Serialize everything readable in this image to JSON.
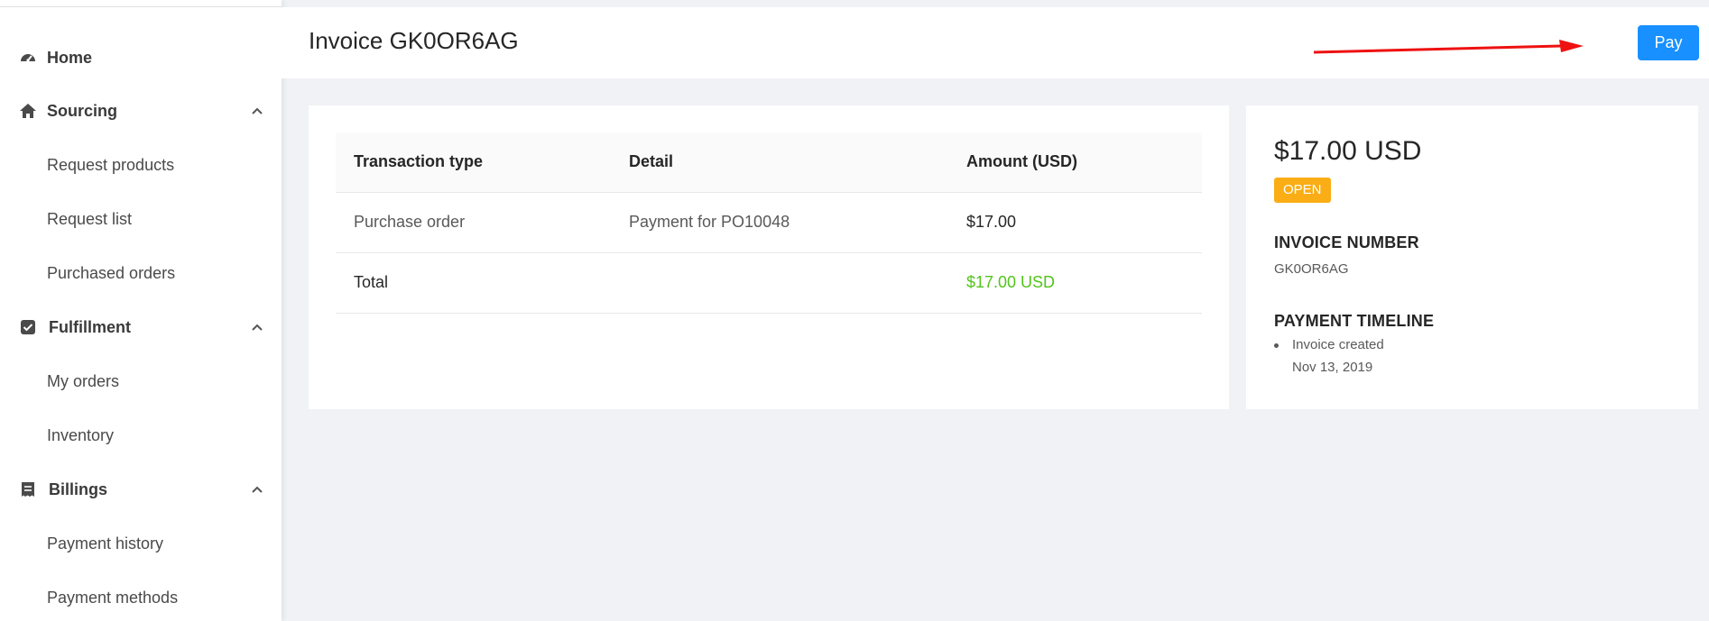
{
  "sidebar": {
    "items": [
      {
        "label": "Home",
        "icon": "dashboard-icon"
      },
      {
        "label": "Sourcing",
        "icon": "home-icon",
        "expanded": true,
        "children": [
          {
            "label": "Request products"
          },
          {
            "label": "Request list"
          },
          {
            "label": "Purchased orders"
          }
        ]
      },
      {
        "label": "Fulfillment",
        "icon": "check-square-icon",
        "expanded": true,
        "children": [
          {
            "label": "My orders"
          },
          {
            "label": "Inventory"
          }
        ]
      },
      {
        "label": "Billings",
        "icon": "receipt-icon",
        "expanded": true,
        "children": [
          {
            "label": "Payment history"
          },
          {
            "label": "Payment methods"
          }
        ]
      }
    ]
  },
  "header": {
    "title": "Invoice GK0OR6AG",
    "pay_label": "Pay"
  },
  "table": {
    "columns": [
      "Transaction type",
      "Detail",
      "Amount (USD)"
    ],
    "rows": [
      {
        "type": "Purchase order",
        "detail": "Payment for PO10048",
        "amount": "$17.00"
      }
    ],
    "total": {
      "label": "Total",
      "amount": "$17.00 USD"
    }
  },
  "summary": {
    "amount": "$17.00 USD",
    "status": "OPEN",
    "invoice_number_heading": "INVOICE NUMBER",
    "invoice_number": "GK0OR6AG",
    "timeline_heading": "PAYMENT TIMELINE",
    "timeline": [
      {
        "title": "Invoice created",
        "date": "Nov 13, 2019"
      }
    ]
  },
  "colors": {
    "primary": "#1890ff",
    "status_open": "#faad14",
    "total_amount": "#52c41a",
    "annotation_arrow": "#ee1111"
  }
}
